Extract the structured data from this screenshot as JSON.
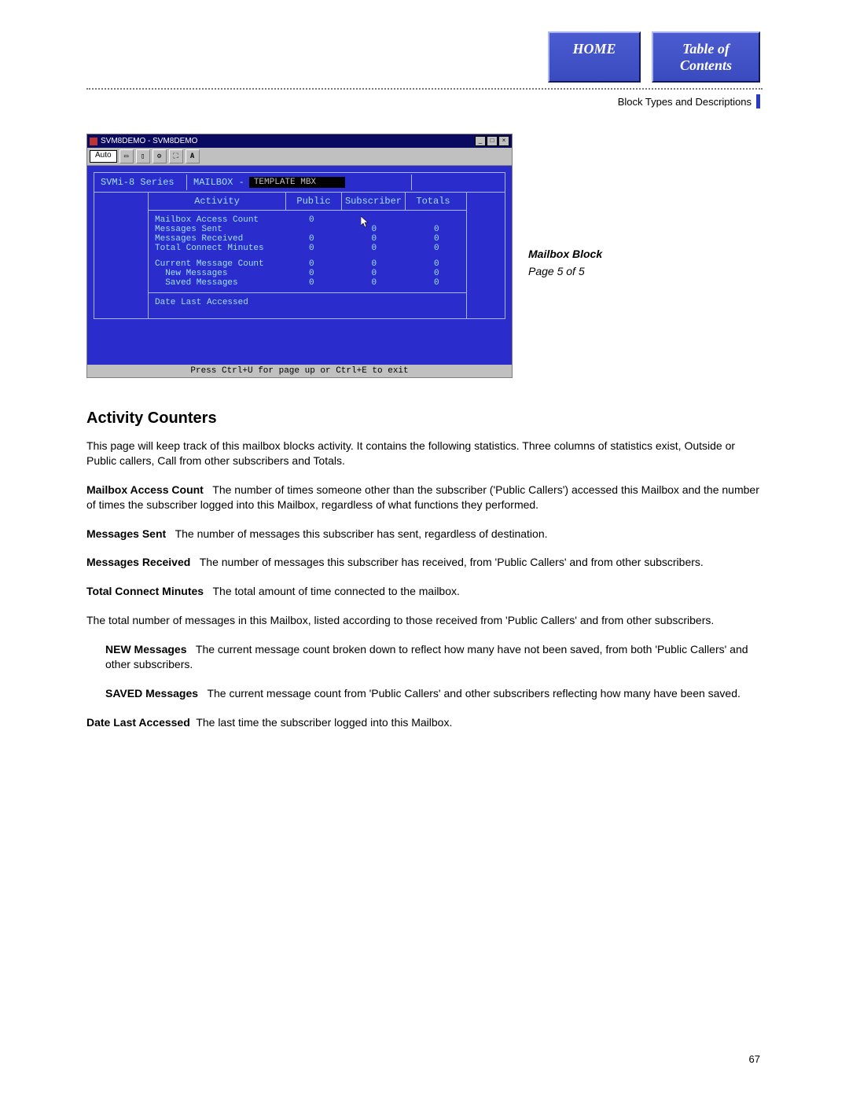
{
  "nav": {
    "home": "HOME",
    "toc_line1": "Table of",
    "toc_line2": "Contents"
  },
  "breadcrumb": "Block Types and Descriptions",
  "window": {
    "title": "SVM8DEMO - SVM8DEMO",
    "auto": "Auto",
    "tool_a": "A",
    "series": "SVMi-8 Series",
    "mailbox_label": "MAILBOX -",
    "mailbox_value": "TEMPLATE MBX",
    "page": "Page 5 of 5",
    "columns": {
      "activity": "Activity",
      "public": "Public",
      "subscriber": "Subscriber",
      "totals": "Totals"
    },
    "rows_group1": [
      {
        "label": "Mailbox Access Count",
        "public": "0",
        "subscriber": "",
        "totals": ""
      },
      {
        "label": "Messages Sent",
        "public": "",
        "subscriber": "0",
        "totals": "0"
      },
      {
        "label": "Messages Received",
        "public": "0",
        "subscriber": "0",
        "totals": "0"
      },
      {
        "label": "Total Connect Minutes",
        "public": "0",
        "subscriber": "0",
        "totals": "0"
      }
    ],
    "rows_group2": [
      {
        "label": "Current Message Count",
        "public": "0",
        "subscriber": "0",
        "totals": "0"
      },
      {
        "label": "New Messages",
        "public": "0",
        "subscriber": "0",
        "totals": "0",
        "indent": true
      },
      {
        "label": "Saved Messages",
        "public": "0",
        "subscriber": "0",
        "totals": "0",
        "indent": true
      }
    ],
    "last_row": "Date Last Accessed",
    "hint": "Press Ctrl+U for page up or Ctrl+E to exit"
  },
  "side": {
    "title": "Mailbox Block",
    "page": "Page 5 of 5"
  },
  "doc": {
    "heading": "Activity Counters",
    "intro": "This page will keep track of this mailbox blocks activity. It contains the following statistics. Three columns of statistics exist, Outside or Public callers, Call from other subscribers and Totals.",
    "mac_t": "Mailbox Access Count",
    "mac_b": "The number of times someone other than the subscriber ('Public Callers') accessed this Mailbox and the number of times the subscriber logged into this Mailbox, regardless of what functions they performed.",
    "ms_t": "Messages Sent",
    "ms_b": "The number of messages this subscriber has sent, regardless of destination.",
    "mr_t": "Messages Received",
    "mr_b": "The number of messages this subscriber has received, from 'Public Callers' and from other subscribers.",
    "tcm_t": "Total Connect Minutes",
    "tcm_b": "The total amount of time connected to the mailbox.",
    "total_msgs": "The total number of messages in this Mailbox, listed according to those received from 'Public Callers' and from other subscribers.",
    "new_t": "NEW Messages",
    "new_b": "The current message count broken down to reflect how many have not been saved, from both 'Public Callers' and other subscribers.",
    "saved_t": "SAVED Messages",
    "saved_b": "The current message count from 'Public Callers' and other subscribers reflecting how many have been saved.",
    "dla_t": "Date Last Accessed",
    "dla_b": "The last time the subscriber logged into this Mailbox."
  },
  "pagenum": "67"
}
